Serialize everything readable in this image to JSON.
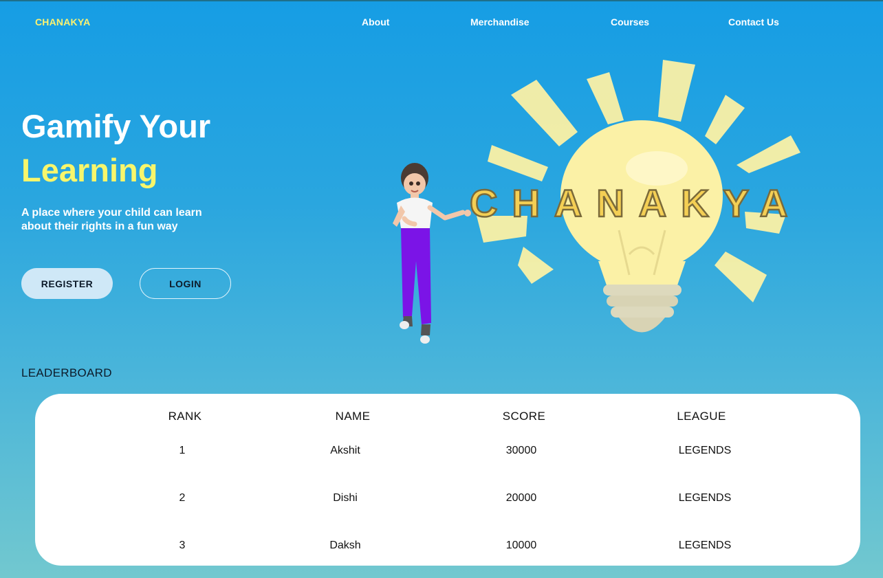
{
  "brand": "CHANAKYA",
  "nav": [
    "About",
    "Merchandise",
    "Courses",
    "Contact Us"
  ],
  "hero": {
    "title_line1": "Gamify Your",
    "title_line2": "Learning",
    "subtitle": "A place where your child can learn about their rights in a fun way",
    "register_label": "REGISTER",
    "login_label": "LOGIN",
    "logo_text": "CHANAKYA"
  },
  "leaderboard": {
    "title": "LEADERBOARD",
    "headers": [
      "RANK",
      "NAME",
      "SCORE",
      "LEAGUE"
    ],
    "rows": [
      {
        "rank": "1",
        "name": "Akshit",
        "score": "30000",
        "league": "LEGENDS"
      },
      {
        "rank": "2",
        "name": "Dishi",
        "score": "20000",
        "league": "LEGENDS"
      },
      {
        "rank": "3",
        "name": "Daksh",
        "score": "10000",
        "league": "LEGENDS"
      }
    ]
  },
  "colors": {
    "accent_yellow": "#f8f66b",
    "bulb_yellow": "#fbf1a6",
    "bg_top": "#169de4",
    "bg_bottom": "#72c8cf"
  }
}
